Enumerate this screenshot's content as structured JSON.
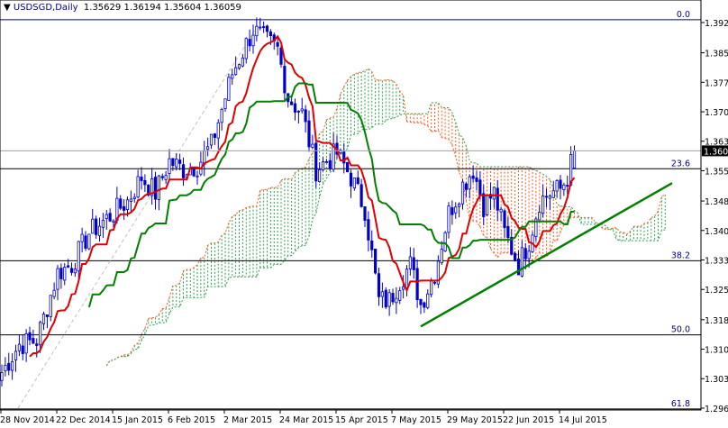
{
  "header": {
    "symbol_timeframe": "USDSGD,Daily",
    "open": "1.35629",
    "high": "1.36194",
    "low": "1.35604",
    "close": "1.36059"
  },
  "chart_data": {
    "type": "candlestick",
    "title": "USDSGD,Daily",
    "indicator": "Ichimoku Kinko Hyo",
    "ylim": [
      1.2945,
      1.3985
    ],
    "y_ticks": [
      "1.39280",
      "1.38520",
      "1.37780",
      "1.37040",
      "1.36300",
      "1.35560",
      "1.34800",
      "1.34060",
      "1.33320",
      "1.32580",
      "1.31820",
      "1.31080",
      "1.30340",
      "1.29600"
    ],
    "current_price": "1.36059",
    "x_ticks": [
      "28 Nov 2014",
      "22 Dec 2014",
      "15 Jan 2015",
      "6 Feb 2015",
      "2 Mar 2015",
      "24 Mar 2015",
      "15 Apr 2015",
      "7 May 2015",
      "29 May 2015",
      "22 Jun 2015",
      "14 Jul 2015"
    ],
    "candle_count": 165,
    "price_path_anchors": [
      [
        0,
        1.305
      ],
      [
        5,
        1.312
      ],
      [
        10,
        1.313
      ],
      [
        16,
        1.33
      ],
      [
        20,
        1.332
      ],
      [
        25,
        1.34
      ],
      [
        32,
        1.345
      ],
      [
        36,
        1.348
      ],
      [
        40,
        1.354
      ],
      [
        44,
        1.35
      ],
      [
        48,
        1.358
      ],
      [
        52,
        1.356
      ],
      [
        56,
        1.357
      ],
      [
        60,
        1.362
      ],
      [
        66,
        1.38
      ],
      [
        72,
        1.391
      ],
      [
        76,
        1.388
      ],
      [
        79,
        1.386
      ],
      [
        82,
        1.374
      ],
      [
        86,
        1.37
      ],
      [
        90,
        1.356
      ],
      [
        93,
        1.358
      ],
      [
        96,
        1.36
      ],
      [
        100,
        1.354
      ],
      [
        104,
        1.346
      ],
      [
        108,
        1.323
      ],
      [
        111,
        1.323
      ],
      [
        114,
        1.328
      ],
      [
        117,
        1.332
      ],
      [
        120,
        1.322
      ],
      [
        124,
        1.33
      ],
      [
        128,
        1.345
      ],
      [
        132,
        1.352
      ],
      [
        135,
        1.356
      ],
      [
        138,
        1.347
      ],
      [
        141,
        1.35
      ],
      [
        144,
        1.34
      ],
      [
        148,
        1.332
      ],
      [
        151,
        1.338
      ],
      [
        154,
        1.348
      ],
      [
        157,
        1.35
      ],
      [
        160,
        1.351
      ],
      [
        162,
        1.354
      ],
      [
        164,
        1.36059
      ]
    ],
    "fibonacci": [
      {
        "level": "0.0",
        "price": 1.3935
      },
      {
        "level": "23.6",
        "price": 1.3561
      },
      {
        "level": "38.2",
        "price": 1.333
      },
      {
        "level": "50.0",
        "price": 1.3144
      },
      {
        "level": "61.8",
        "price": 1.2958
      }
    ],
    "trendline": {
      "from": [
        120,
        1.3165
      ],
      "to": [
        192,
        1.3525
      ]
    }
  }
}
